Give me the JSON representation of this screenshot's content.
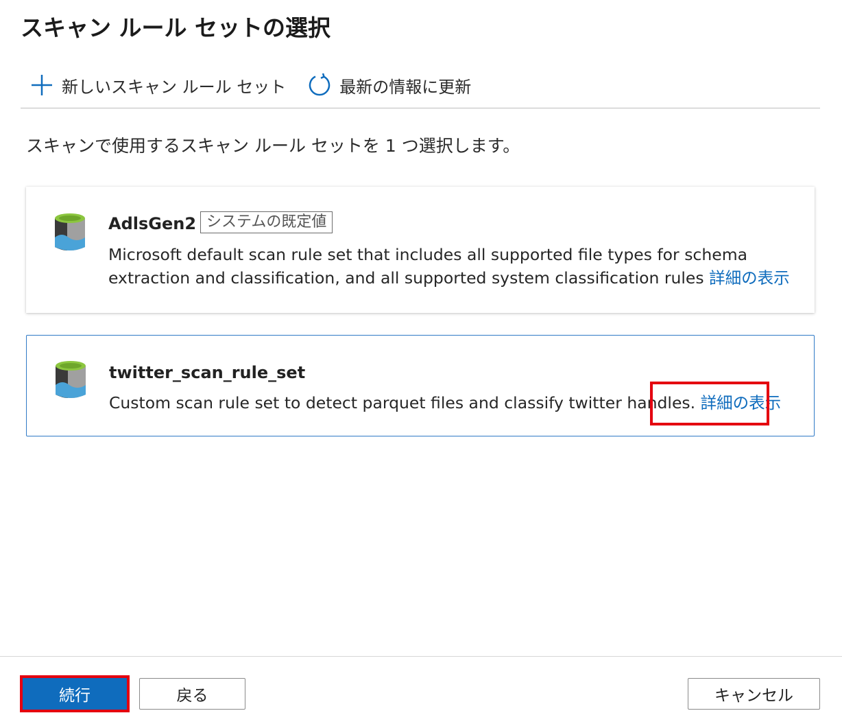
{
  "page": {
    "title": "スキャン ルール セットの選択"
  },
  "toolbar": {
    "new_label": "新しいスキャン ルール セット",
    "refresh_label": "最新の情報に更新",
    "new_icon": "plus-icon",
    "refresh_icon": "refresh-icon"
  },
  "instruction": "スキャンで使用するスキャン ルール セットを 1 つ選択します。",
  "rule_sets": [
    {
      "name": "AdlsGen2",
      "badge": "システムの既定値",
      "description": "Microsoft default scan rule set that includes all supported file types for schema extraction and classification, and all supported system classification rules",
      "link_label": "詳細の表示",
      "icon": "storage-database-icon",
      "selected": false
    },
    {
      "name": "twitter_scan_rule_set",
      "description": "Custom scan rule set to detect parquet files and classify twitter handles.",
      "link_label": "詳細の表示",
      "icon": "storage-database-icon",
      "selected": true
    }
  ],
  "footer": {
    "continue_label": "続行",
    "back_label": "戻る",
    "cancel_label": "キャンセル"
  },
  "colors": {
    "accent": "#0f6cbd",
    "highlight": "#e4000f",
    "selected_border": "#2f79c6"
  }
}
